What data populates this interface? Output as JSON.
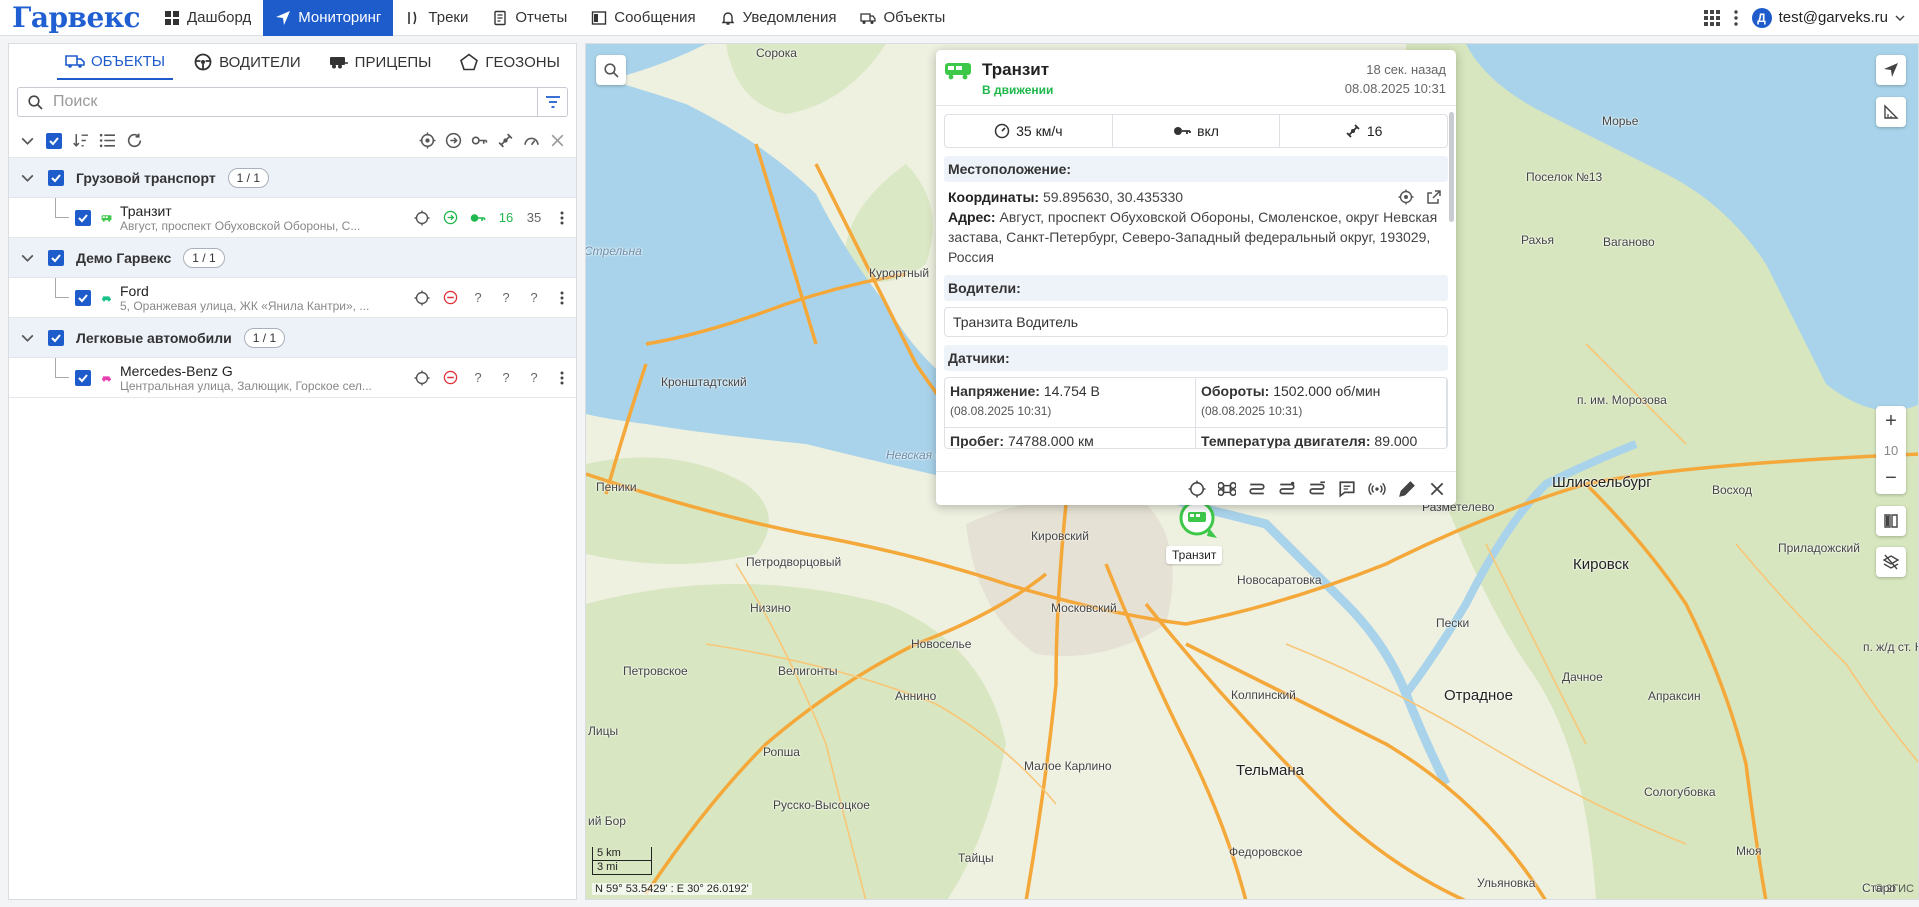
{
  "app": {
    "logo": "Гарвекс"
  },
  "nav": {
    "items": [
      {
        "label": "Дашборд",
        "icon": "dashboard-icon"
      },
      {
        "label": "Мониторинг",
        "icon": "navigation-arrow-icon",
        "active": true
      },
      {
        "label": "Треки",
        "icon": "tracks-icon"
      },
      {
        "label": "Отчеты",
        "icon": "document-icon"
      },
      {
        "label": "Сообщения",
        "icon": "messages-icon"
      },
      {
        "label": "Уведомления",
        "icon": "bell-icon"
      },
      {
        "label": "Объекты",
        "icon": "truck-icon"
      }
    ],
    "user": {
      "avatar": "Д",
      "email": "test@garveks.ru"
    }
  },
  "sidebar": {
    "tabs": [
      {
        "label": "Объекты",
        "icon": "truck-icon",
        "active": true
      },
      {
        "label": "Водители",
        "icon": "steering-wheel-icon"
      },
      {
        "label": "Прицепы",
        "icon": "trailer-icon"
      },
      {
        "label": "Геозоны",
        "icon": "pentagon-icon"
      }
    ],
    "search_placeholder": "Поиск",
    "groups": [
      {
        "name": "Грузовой транспорт",
        "count": "1 / 1",
        "items": [
          {
            "name": "Транзит",
            "address": "Август, проспект Обуховской Обороны, С...",
            "color": "#3dc84a",
            "status": "moving",
            "satellites": "16",
            "speed": "35"
          }
        ]
      },
      {
        "name": "Демо Гарвекс",
        "count": "1 / 1",
        "items": [
          {
            "name": "Ford",
            "address": "5, Оранжевая улица, ЖК «Янила Кантри», ...",
            "color": "#19c28a",
            "status": "stopped",
            "satellites": "?",
            "speed": "?"
          }
        ]
      },
      {
        "name": "Легковые автомобили",
        "count": "1 / 1",
        "items": [
          {
            "name": "Mercedes-Benz G",
            "address": "Центральная улица, Залющик, Горское сел...",
            "color": "#e63fb0",
            "status": "stopped",
            "satellites": "?",
            "speed": "?"
          }
        ]
      }
    ],
    "unknown_mark": "?"
  },
  "popup": {
    "title": "Транзит",
    "status": "В движении",
    "time_ago": "18 сек. назад",
    "timestamp": "08.08.2025 10:31",
    "metrics": {
      "speed": "35 км/ч",
      "ignition": "вкл",
      "satellites": "16"
    },
    "location_header": "Местоположение:",
    "coords_label": "Координаты:",
    "coords_value": "59.895630, 30.435330",
    "address_label": "Адрес:",
    "address_value": "Август, проспект Обуховской Обороны, Смоленское, округ Невская застава, Санкт-Петербург, Северо-Западный федеральный округ, 193029, Россия",
    "drivers_header": "Водители:",
    "driver": "Транзита Водитель",
    "sensors_header": "Датчики:",
    "sensors": [
      {
        "label": "Напряжение:",
        "value": "14.754 В",
        "time": "(08.08.2025 10:31)"
      },
      {
        "label": "Обороты:",
        "value": "1502.000 об/мин",
        "time": "(08.08.2025 10:31)"
      },
      {
        "label": "Пробег:",
        "value": "74788.000 км",
        "time": ""
      },
      {
        "label": "Температура двигателя:",
        "value": "89.000",
        "time": ""
      }
    ]
  },
  "map": {
    "zoom": "10",
    "scale_km": "5 km",
    "scale_mi": "3 mi",
    "cursor_coords": "N 59° 53.5429' : E 30° 26.0192'",
    "copyright": "© 2ГИС",
    "marker_label": "Транзит",
    "places": [
      {
        "name": "Шлиссельбург",
        "big": true
      },
      {
        "name": "Кировск",
        "big": true
      },
      {
        "name": "Отрадное",
        "big": true
      },
      {
        "name": "Тельмана",
        "big": true
      },
      {
        "name": "Морье"
      },
      {
        "name": "Поселок №13"
      },
      {
        "name": "Рахья"
      },
      {
        "name": "Ваганово"
      },
      {
        "name": "п. им. Морозова"
      },
      {
        "name": "Разметелево"
      },
      {
        "name": "Восход"
      },
      {
        "name": "Приладожский"
      },
      {
        "name": "Курортный"
      },
      {
        "name": "Кронштадтский"
      },
      {
        "name": "Пеники"
      },
      {
        "name": "Петродворцовый"
      },
      {
        "name": "Кировский"
      },
      {
        "name": "Невская губа"
      },
      {
        "name": "Новосаратовка"
      },
      {
        "name": "Низино"
      },
      {
        "name": "Московский"
      },
      {
        "name": "Новоселье"
      },
      {
        "name": "Петровское"
      },
      {
        "name": "Велигонты"
      },
      {
        "name": "Аннино"
      },
      {
        "name": "Пески"
      },
      {
        "name": "Дачное"
      },
      {
        "name": "Апраксин"
      },
      {
        "name": "Колпинский"
      },
      {
        "name": "Ропша"
      },
      {
        "name": "Малое Карлино"
      },
      {
        "name": "Русско-Высоцкое"
      },
      {
        "name": "Сологубовка"
      },
      {
        "name": "Федоровское"
      },
      {
        "name": "Тайцы"
      },
      {
        "name": "Ульяновка"
      },
      {
        "name": "Мюя"
      },
      {
        "name": "Старо"
      },
      {
        "name": "п. ж/д ст. Н"
      },
      {
        "name": "Лицы"
      },
      {
        "name": "ий Бор"
      },
      {
        "name": "Сорока"
      },
      {
        "name": "Стрельна"
      }
    ]
  }
}
